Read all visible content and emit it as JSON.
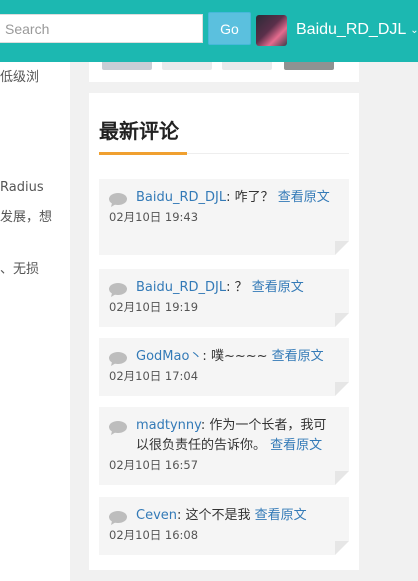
{
  "search": {
    "placeholder": "Search"
  },
  "go_label": "Go",
  "user": {
    "name": "Baidu_RD_DJL",
    "caret": "⌄"
  },
  "left_snippets": [
    "低级浏",
    "Radius",
    "发展，想",
    "、无损"
  ],
  "widget": {
    "title": "最新评论",
    "comments": [
      {
        "author": "Baidu_RD_DJL",
        "separator": ": ",
        "text": "咋了？ ",
        "link": "查看原文",
        "date": "02月10日 19:43"
      },
      {
        "author": "Baidu_RD_DJL",
        "separator": ": ",
        "text": "？ ",
        "link": "查看原文",
        "date": "02月10日 19:19"
      },
      {
        "author": "GodMao丶",
        "separator": ": ",
        "text": "噗~~~~ ",
        "link": "查看原文",
        "date": "02月10日 17:04"
      },
      {
        "author": "madtynny",
        "separator": ": ",
        "text": "作为一个长者，我可以很负责任的告诉你。 ",
        "link": "查看原文",
        "date": "02月10日 16:57"
      },
      {
        "author": "Ceven",
        "separator": ": ",
        "text": "这个不是我 ",
        "link": "查看原文",
        "date": "02月10日 16:08"
      }
    ]
  }
}
